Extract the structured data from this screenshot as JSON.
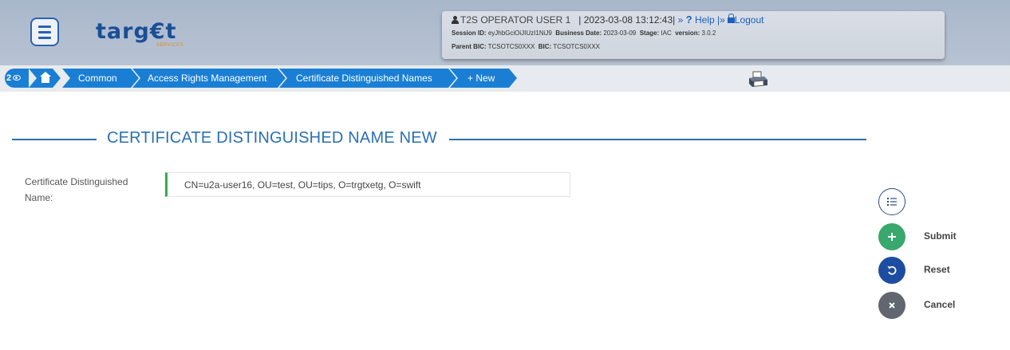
{
  "header": {
    "logo_text": "targ€t",
    "logo_sub": "SERVICES",
    "user": {
      "name": "T2S OPERATOR USER 1",
      "datetime": "2023-03-08 13:12:43|",
      "sep1": "»",
      "help_label": "Help",
      "sep2": "|»",
      "logout_label": "Logout",
      "session_label": "Session ID:",
      "session_value": "eyJhbGciOiJIUzI1NiJ9",
      "business_date_label": "Business Date:",
      "business_date_value": "2023-03-09",
      "stage_label": "Stage:",
      "stage_value": "IAC",
      "version_label": "version:",
      "version_value": "3.0.2",
      "parent_bic_label": "Parent BIC:",
      "parent_bic_value": "TCSOTCS0XXX",
      "bic_label": "BIC:",
      "bic_value": "TCSOTCS0XXX"
    }
  },
  "breadcrumb": {
    "history_count": "2",
    "items": [
      "Common",
      "Access Rights Management",
      "Certificate Distinguished Names",
      "+ New"
    ]
  },
  "page_title": "CERTIFICATE DISTINGUISHED NAME NEW",
  "form": {
    "dn_label": "Certificate Distinguished Name:",
    "dn_value": "CN=u2a-user16, OU=test, OU=tips, O=trgtxetg, O=swift"
  },
  "actions": {
    "submit_label": "Submit",
    "reset_label": "Reset",
    "cancel_label": "Cancel"
  },
  "colors": {
    "accent": "#1a7fd4",
    "title": "#2a6fb5",
    "submit": "#38a86d",
    "reset": "#1d4da0",
    "cancel": "#616670",
    "required_marker": "#3aa84a"
  },
  "icons": [
    "menu-icon",
    "user-icon",
    "help-icon",
    "lock-icon",
    "eye-icon",
    "home-icon",
    "printer-icon",
    "list-icon",
    "plus-icon",
    "undo-icon",
    "close-icon"
  ]
}
